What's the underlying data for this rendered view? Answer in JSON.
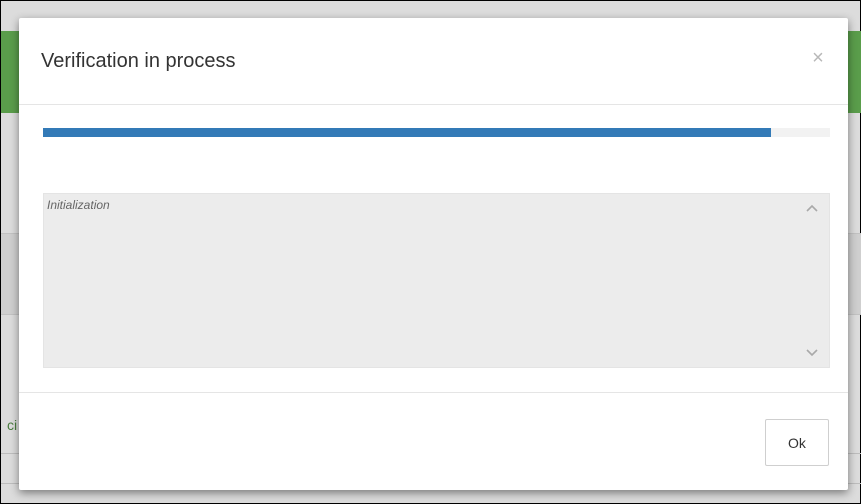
{
  "background": {
    "partial_text": "ci",
    "accent_color": "#5a9d4b"
  },
  "dialog": {
    "title": "Verification in process",
    "close_symbol": "×",
    "progress": {
      "value_fraction": 0.925,
      "color": "#337ab7"
    },
    "log": {
      "text": "Initialization",
      "scroll_up_icon": "chevron-up-icon",
      "scroll_down_icon": "chevron-down-icon"
    },
    "footer": {
      "ok_label": "Ok"
    }
  }
}
